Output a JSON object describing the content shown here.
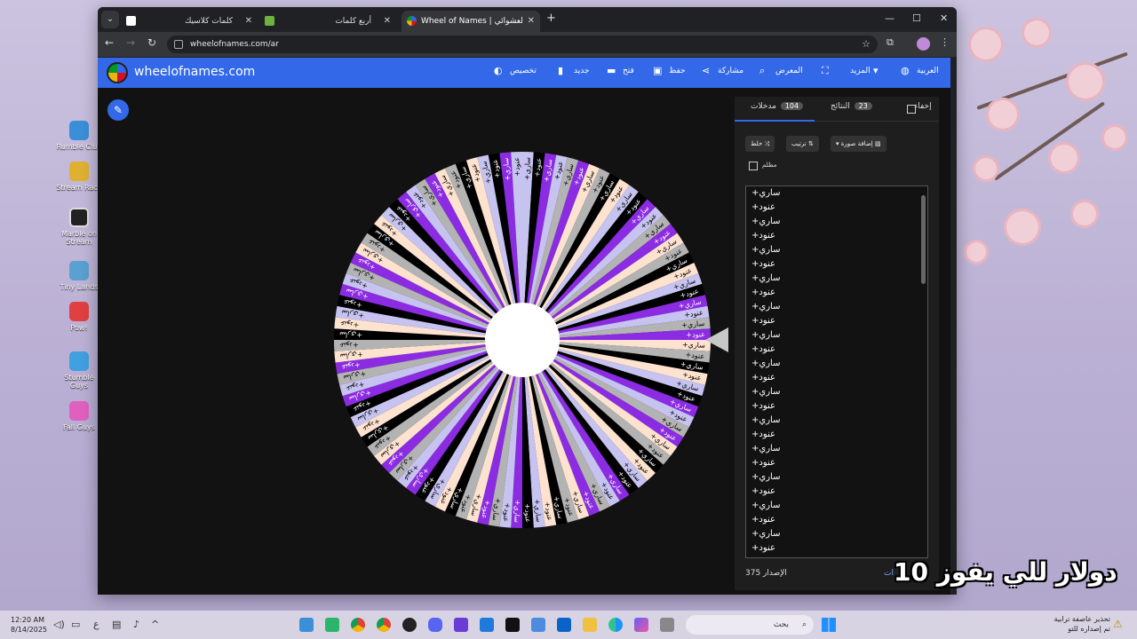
{
  "desktop": {
    "icons": [
      {
        "label": "Rumble Club",
        "icon": "rumble-club-icon",
        "color": "#3a8fd8"
      },
      {
        "label": "Stream Race",
        "icon": "stream-race-icon",
        "color": "#e0b030"
      },
      {
        "label": "Marble on Stream",
        "icon": "marble-icon",
        "color": "#222222"
      },
      {
        "label": "Tiny Lands",
        "icon": "tiny-lands-icon",
        "color": "#5aa0d0"
      },
      {
        "label": "Pow!",
        "icon": "pow-icon",
        "color": "#e04040"
      },
      {
        "label": "Stumble Guys",
        "icon": "stumble-guys-icon",
        "color": "#40a0e0"
      },
      {
        "label": "Fall Guys",
        "icon": "fall-guys-icon",
        "color": "#e060c0"
      }
    ]
  },
  "browser": {
    "tabs": [
      {
        "title": "كلمات كلاسيك",
        "active": false
      },
      {
        "title": "أربع كلمات",
        "active": false
      },
      {
        "title": "Wheel of Names | منتقي الاسم العشوائي",
        "active": true
      }
    ],
    "new_tab": "+",
    "url": "wheelofnames.com/ar"
  },
  "site": {
    "title": "wheelofnames.com",
    "brand_color": "#3369e8",
    "menu": {
      "language": "العربية",
      "more": "المزيد",
      "gallery": "المعرض",
      "share": "مشاركة",
      "save": "حفظ",
      "open": "فتح",
      "new": "جديد",
      "customize": "تخصيص"
    }
  },
  "panel": {
    "hide_label": "إخفاء",
    "results_label": "النتائج",
    "results_count": "23",
    "entries_label": "مدخلات",
    "entries_count": "104",
    "shuffle_label": "خلط",
    "sort_label": "ترتيب",
    "add_image_label": "إضافة صورة",
    "bold_label": "مظلم",
    "entries": [
      "+ساري",
      "+عنود",
      "+ساري",
      "+عنود",
      "+ساري",
      "+عنود",
      "+ساري",
      "+عنود",
      "+ساري",
      "+عنود",
      "+ساري",
      "+عنود",
      "+ساري",
      "+عنود",
      "+ساري",
      "+عنود",
      "+ساري",
      "+عنود",
      "+ساري",
      "+عنود",
      "+ساري",
      "+عنود",
      "+ساري",
      "+عنود",
      "+ساري",
      "+عنود"
    ],
    "version_label": "الإصدار 375",
    "bottom_link": "ات"
  },
  "wheel": {
    "slice_count": 104,
    "labels": [
      "+ساري",
      "+عنود"
    ],
    "colors": [
      "#c6c3f0",
      "#8b2be2",
      "#b3b3b3",
      "#fde3cf",
      "#000000"
    ]
  },
  "overlay_text": "دولار للي يفوز 10",
  "taskbar": {
    "time": "12:20 AM",
    "date": "8/14/2025",
    "search_placeholder": "بحث",
    "news_line1": "تحذير عاصفة ترابية",
    "news_line2": "تم إصداره للتو",
    "lang": "ع"
  }
}
